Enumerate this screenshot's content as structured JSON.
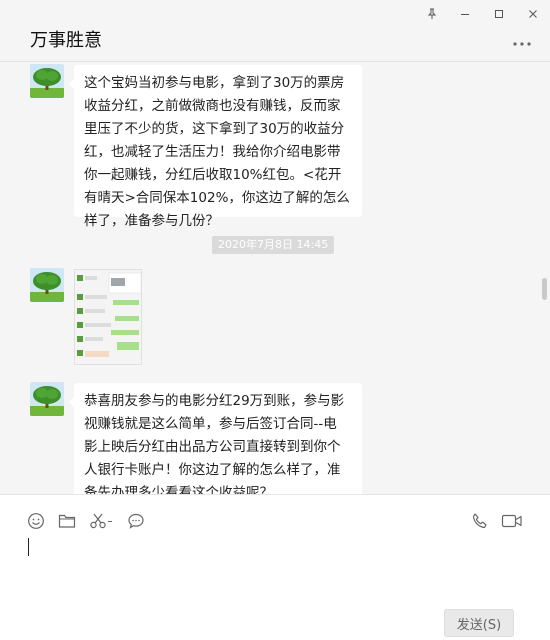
{
  "window": {
    "title": "万事胜意"
  },
  "icons": {
    "pin": "pin-icon",
    "minimize": "minimize-icon",
    "maximize": "maximize-icon",
    "close": "close-icon",
    "more": "more-icon",
    "emoji": "emoji-icon",
    "folder": "folder-icon",
    "scissors": "scissors-icon",
    "chat_history": "chat-bubble-icon",
    "phone": "phone-icon",
    "video": "video-icon"
  },
  "chat": {
    "messages": [
      {
        "type": "text",
        "from": "contact",
        "lines": [
          "这个宝妈当初参与电影，拿到了30万的票房",
          "收益分红，之前做微商也没有赚钱，反而家",
          "里压了不少的货，这下拿到了30万的收益分",
          "红，也减轻了生活压力！我给你介绍电影带",
          "你一起赚钱，分红后收取10%红包。<花开",
          "有晴天>合同保本102%，你这边了解的怎么",
          "样了，准备参与几份？"
        ]
      },
      {
        "type": "timestamp",
        "text": "2020年7月8日 14:45"
      },
      {
        "type": "image",
        "from": "contact",
        "description": "chat screenshot"
      },
      {
        "type": "text",
        "from": "contact",
        "lines": [
          "恭喜朋友参与的电影分红29万到账，参与影",
          "视赚钱就是这么简单，参与后签订合同--电",
          "影上映后分红由出品方公司直接转到到你个",
          "人银行卡账户！你这边了解的怎么样了，准",
          "备先办理多少看看这个收益呢？"
        ]
      }
    ]
  },
  "composer": {
    "input_value": "",
    "send_label": "发送(S)"
  },
  "colors": {
    "background": "#f5f5f5",
    "bubble": "#ffffff",
    "timestamp_bg": "#dadada",
    "composer_bg": "#ffffff"
  }
}
